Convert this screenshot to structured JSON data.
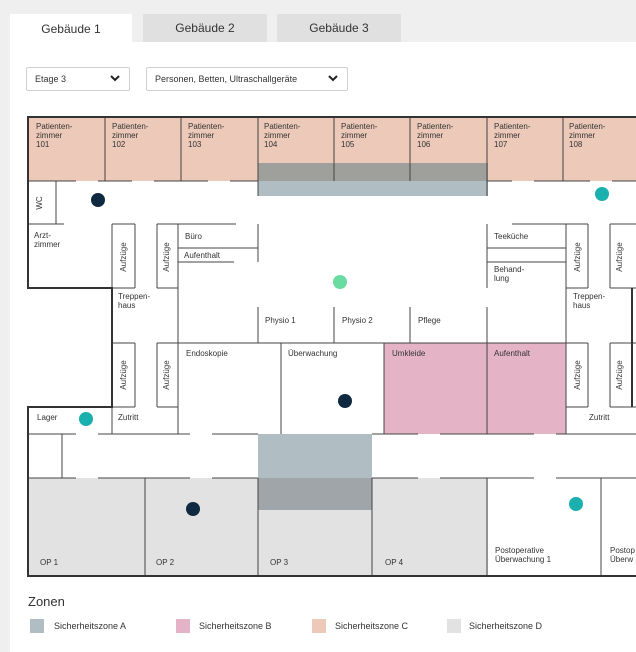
{
  "tabs": [
    {
      "label": "Gebäude 1",
      "active": true
    },
    {
      "label": "Gebäude 2",
      "active": false
    },
    {
      "label": "Gebäude 3",
      "active": false
    }
  ],
  "filters": {
    "floor": "Etage 3",
    "devices": "Personen, Betten, Ultraschallgeräte"
  },
  "colors": {
    "zone_a": "#b0bec4",
    "zone_b": "#e4b4c6",
    "zone_c": "#ecc9b8",
    "zone_d": "#e2e2e2",
    "marker_dark": "#0f2a40",
    "marker_teal": "#1ab0ae",
    "marker_mint": "#69dca2"
  },
  "plan": {
    "patient_rooms": [
      "Patienten-|zimmer|101",
      "Patienten-|zimmer|102",
      "Patienten-|zimmer|103",
      "Patienten-|zimmer|104",
      "Patienten-|zimmer|105",
      "Patienten-|zimmer|106",
      "Patienten-|zimmer|107",
      "Patienten-|zimmer|108"
    ],
    "wc": "WC",
    "arztzimmer": "Arzt-|zimmer",
    "aufzuege": "Aufzüge",
    "buero": "Büro",
    "aufenthalt": "Aufenthalt",
    "teekueche": "Teeküche",
    "behandlung": "Behand-|lung",
    "treppenhaus": "Treppen-|haus",
    "physio1": "Physio 1",
    "physio2": "Physio 2",
    "pflege": "Pflege",
    "endoskopie": "Endoskopie",
    "ueberwachung": "Überwachung",
    "umkleide": "Umkleide",
    "lager": "Lager",
    "zutritt": "Zutritt",
    "op_rooms": [
      "OP 1",
      "OP 2",
      "OP 3",
      "OP 4"
    ],
    "postop1": "Postoperative|Überwachung 1",
    "postop2": "Postop|Überw"
  },
  "markers": [
    {
      "type": "dark",
      "location": "Flur bei WC"
    },
    {
      "type": "teal",
      "location": "Flur bei Patientenzimmer 108"
    },
    {
      "type": "mint",
      "location": "Mittlerer Flur"
    },
    {
      "type": "dark",
      "location": "Überwachung"
    },
    {
      "type": "teal",
      "location": "Lager"
    },
    {
      "type": "dark",
      "location": "OP 2"
    },
    {
      "type": "teal",
      "location": "Postoperative Überwachung 1"
    }
  ],
  "legend": {
    "title": "Zonen",
    "items": [
      {
        "label": "Sicherheitszone A",
        "color": "#b0bec4"
      },
      {
        "label": "Sicherheitszone B",
        "color": "#e4b4c6"
      },
      {
        "label": "Sicherheitszone C",
        "color": "#ecc9b8"
      },
      {
        "label": "Sicherheitszone D",
        "color": "#e2e2e2"
      }
    ]
  }
}
